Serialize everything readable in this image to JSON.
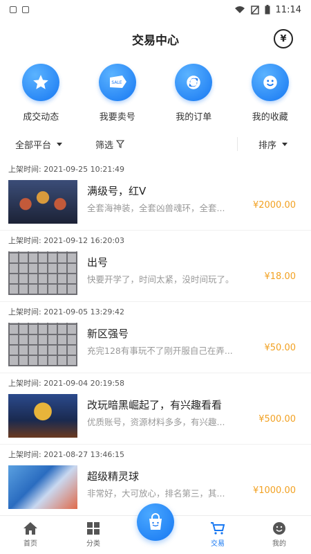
{
  "status_bar": {
    "time": "11:14"
  },
  "header": {
    "title": "交易中心",
    "wallet_icon": "yuan-wallet-icon"
  },
  "quick_nav": [
    {
      "label": "成交动态",
      "icon": "star-icon"
    },
    {
      "label": "我要卖号",
      "icon": "sale-tag-icon"
    },
    {
      "label": "我的订单",
      "icon": "refresh-order-icon"
    },
    {
      "label": "我的收藏",
      "icon": "smile-favorite-icon"
    }
  ],
  "filters": {
    "platform": "全部平台",
    "screen": "筛选",
    "sort": "排序"
  },
  "listings": [
    {
      "time": "上架时间: 2021-09-25 10:21:49",
      "title": "满级号，红V",
      "desc": "全套海神装，全套凶兽魂环，全套...",
      "price": "¥2000.00"
    },
    {
      "time": "上架时间: 2021-09-12 16:20:03",
      "title": "出号",
      "desc": "快要开学了，时间太紧，没时间玩了。",
      "price": "¥18.00"
    },
    {
      "time": "上架时间: 2021-09-05 13:29:42",
      "title": "新区强号",
      "desc": "充完128有事玩不了刚开服自己在弄...",
      "price": "¥50.00"
    },
    {
      "time": "上架时间: 2021-09-04 20:19:58",
      "title": "改玩暗黑崛起了，有兴趣看看",
      "desc": "优质账号，资源材料多多，有兴趣...",
      "price": "¥500.00"
    },
    {
      "time": "上架时间: 2021-08-27 13:46:15",
      "title": "超级精灵球",
      "desc": "非常好，大可放心，排名第三，其...",
      "price": "¥1000.00"
    }
  ],
  "tab_bar": {
    "home": "首页",
    "category": "分类",
    "trade": "交易",
    "mine": "我的"
  },
  "colors": {
    "accent": "#1677f2",
    "price": "#f2a122"
  }
}
